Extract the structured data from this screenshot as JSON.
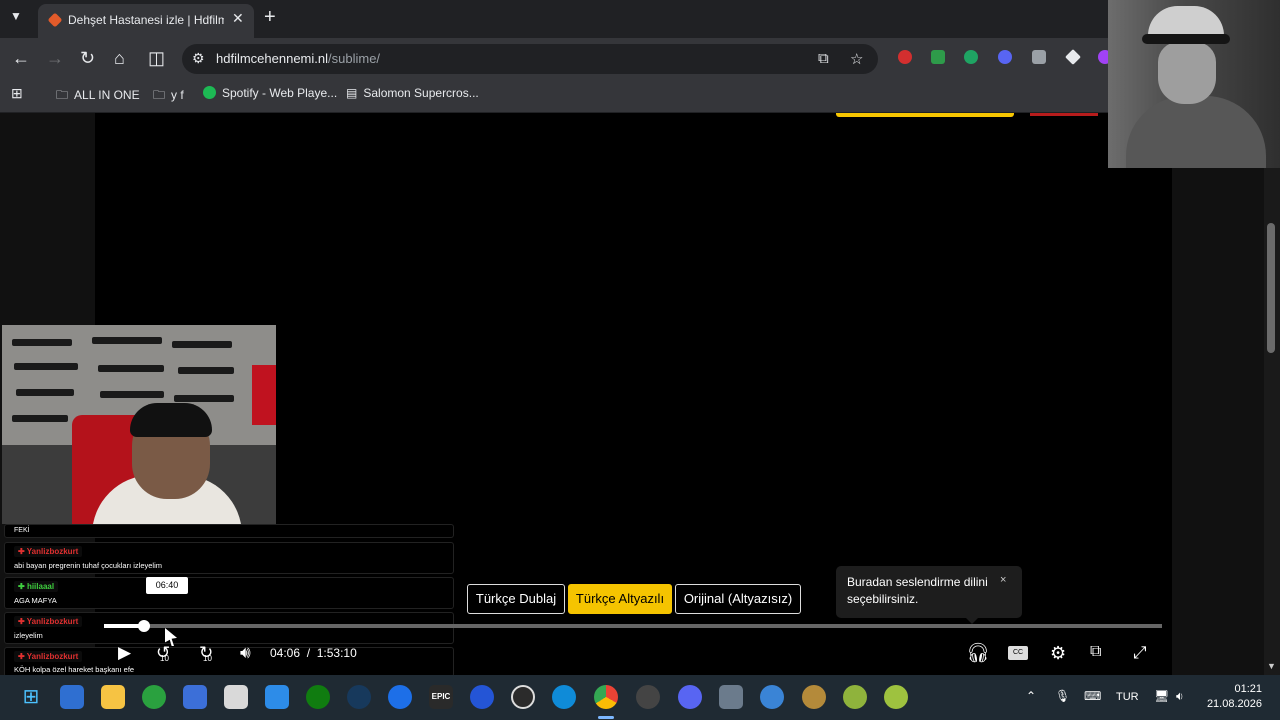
{
  "browser": {
    "tab_title": "Dehşet Hastanesi izle | Hdfilmcehennemi",
    "tab_close": "✕",
    "new_tab": "+",
    "url_domain": "hdfilmcehennemi.nl",
    "url_path": "/sublime/",
    "bookmarks": [
      {
        "label": "ALL IN ONE",
        "icon": "folder-icon"
      },
      {
        "label": "y f",
        "icon": "folder-icon"
      },
      {
        "label": "Spotify - Web Playe...",
        "icon": "spotify-icon"
      },
      {
        "label": "Salomon Supercros...",
        "icon": "bookmark-page-icon"
      }
    ]
  },
  "chat": [
    {
      "user": "",
      "message": "FEKİ"
    },
    {
      "user": "Yanlizbozkurt",
      "message": "abi bayan pregrenin tuhaf çocukları izleyelim",
      "badge": "red"
    },
    {
      "user": "hiilaaal",
      "message": "AGA MAFYA",
      "badge": "green"
    },
    {
      "user": "Yanlizbozkurt",
      "message": "izleyelim",
      "badge": "red"
    },
    {
      "user": "Yanlizbozkurt",
      "message": "KÖH kolpa özel hareket başkanı efe",
      "badge": "red"
    }
  ],
  "player": {
    "lang_options": [
      "Türkçe Dublaj",
      "Türkçe Altyazılı",
      "Orijinal (Altyazısız)"
    ],
    "active_lang": "Türkçe Altyazılı",
    "tooltip": "Buradan seslendirme dilini seçebilirsiniz.",
    "tooltip_close": "×",
    "hover_time": "06:40",
    "current_time": "04:06",
    "separator": "/",
    "duration": "1:53:10",
    "progress_fraction": 0.036,
    "rewind_label": "10",
    "forward_label": "10",
    "cc_label": "CC"
  },
  "taskbar": {
    "language": "TUR",
    "time": "01:21",
    "date": "21.08.2026",
    "epic_label": "EPIC"
  },
  "colors": {
    "accent_yellow": "#f5c400",
    "chat_red": "#e03030",
    "chat_green": "#3fcf3f",
    "browser_dark": "#202124"
  }
}
